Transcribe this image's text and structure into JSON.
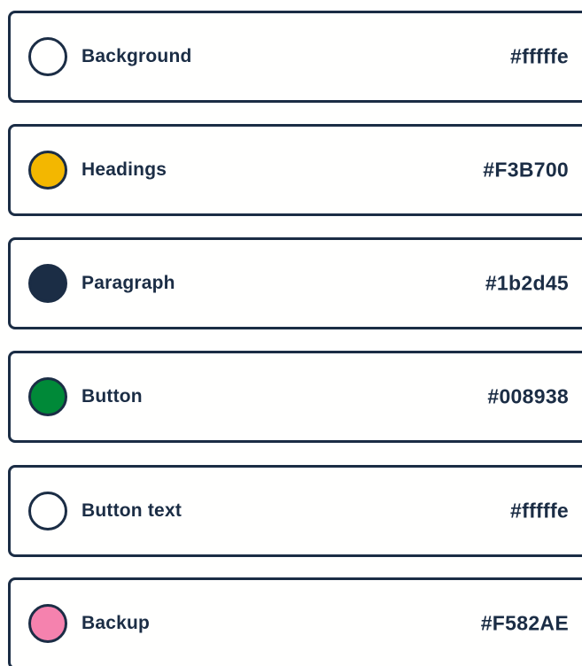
{
  "palette": {
    "items": [
      {
        "label": "Background",
        "hex": "#fffffe",
        "swatch_color": "#fffffe"
      },
      {
        "label": "Headings",
        "hex": "#F3B700",
        "swatch_color": "#F3B700"
      },
      {
        "label": "Paragraph",
        "hex": "#1b2d45",
        "swatch_color": "#1b2d45"
      },
      {
        "label": "Button",
        "hex": "#008938",
        "swatch_color": "#008938"
      },
      {
        "label": "Button text",
        "hex": "#fffffe",
        "swatch_color": "#fffffe"
      },
      {
        "label": "Backup",
        "hex": "#F582AE",
        "swatch_color": "#F582AE"
      }
    ]
  },
  "colors": {
    "border": "#1b2d45",
    "text": "#1b2d45",
    "page_background": "#fffffe"
  }
}
